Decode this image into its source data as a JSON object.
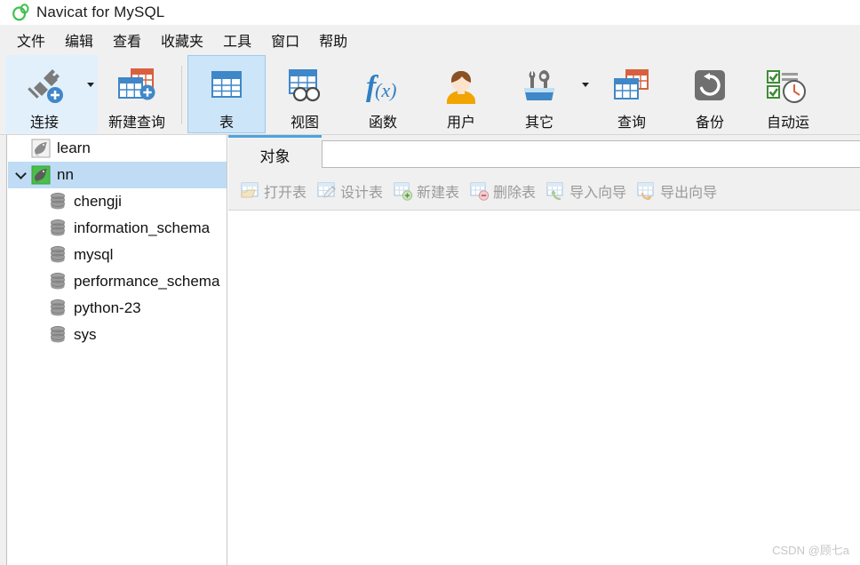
{
  "window": {
    "title": "Navicat for MySQL",
    "logo_icon": "navicat-logo-icon"
  },
  "menubar": {
    "items": [
      {
        "label": "文件",
        "name": "menu-file"
      },
      {
        "label": "编辑",
        "name": "menu-edit"
      },
      {
        "label": "查看",
        "name": "menu-view"
      },
      {
        "label": "收藏夹",
        "name": "menu-favorites"
      },
      {
        "label": "工具",
        "name": "menu-tools"
      },
      {
        "label": "窗口",
        "name": "menu-window"
      },
      {
        "label": "帮助",
        "name": "menu-help"
      }
    ]
  },
  "toolbar": {
    "items": [
      {
        "label": "连接",
        "icon": "connection-plug-add-icon",
        "state": "hover",
        "has_dropdown": true
      },
      {
        "label": "新建查询",
        "icon": "new-query-icon",
        "state": "normal",
        "has_dropdown": false
      },
      {
        "label": "表",
        "icon": "table-icon",
        "state": "active",
        "has_dropdown": false
      },
      {
        "label": "视图",
        "icon": "view-icon",
        "state": "normal",
        "has_dropdown": false
      },
      {
        "label": "函数",
        "icon": "function-fx-icon",
        "state": "normal",
        "has_dropdown": false
      },
      {
        "label": "用户",
        "icon": "user-icon",
        "state": "normal",
        "has_dropdown": false
      },
      {
        "label": "其它",
        "icon": "other-toolbox-icon",
        "state": "normal",
        "has_dropdown": true
      },
      {
        "label": "查询",
        "icon": "query-icon",
        "state": "normal",
        "has_dropdown": false
      },
      {
        "label": "备份",
        "icon": "backup-restore-icon",
        "state": "normal",
        "has_dropdown": false
      },
      {
        "label": "自动运",
        "icon": "automation-checklist-clock-icon",
        "state": "normal",
        "has_dropdown": false
      }
    ]
  },
  "sidebar": {
    "tree": [
      {
        "label": "learn",
        "icon": "connection-dolphin-gray-icon",
        "level": 0,
        "expanded": false,
        "selected": false
      },
      {
        "label": "nn",
        "icon": "connection-dolphin-green-icon",
        "level": 0,
        "expanded": true,
        "selected": true
      },
      {
        "label": "chengji",
        "icon": "database-icon",
        "level": 1,
        "expanded": false,
        "selected": false
      },
      {
        "label": "information_schema",
        "icon": "database-icon",
        "level": 1,
        "expanded": false,
        "selected": false
      },
      {
        "label": "mysql",
        "icon": "database-icon",
        "level": 1,
        "expanded": false,
        "selected": false
      },
      {
        "label": "performance_schema",
        "icon": "database-icon",
        "level": 1,
        "expanded": false,
        "selected": false
      },
      {
        "label": "python-23",
        "icon": "database-icon",
        "level": 1,
        "expanded": false,
        "selected": false
      },
      {
        "label": "sys",
        "icon": "database-icon",
        "level": 1,
        "expanded": false,
        "selected": false
      }
    ]
  },
  "main": {
    "tab": {
      "label": "对象"
    },
    "filter_value": "",
    "filter_placeholder": "",
    "actions": [
      {
        "label": "打开表",
        "icon": "open-table-icon",
        "enabled": false
      },
      {
        "label": "设计表",
        "icon": "design-table-icon",
        "enabled": false
      },
      {
        "label": "新建表",
        "icon": "new-table-icon",
        "enabled": false
      },
      {
        "label": "删除表",
        "icon": "delete-table-icon",
        "enabled": false
      },
      {
        "label": "导入向导",
        "icon": "import-wizard-icon",
        "enabled": false
      },
      {
        "label": "导出向导",
        "icon": "export-wizard-icon",
        "enabled": false
      }
    ]
  },
  "watermark": {
    "text": "CSDN @顾七a"
  },
  "colors": {
    "accent_blue": "#3f87c8",
    "tab_underline": "#4ea3e0",
    "selection": "#bfdcf4",
    "toolbar_bg": "#f0f0f0",
    "active_button": "#cde5f8",
    "connected_green": "#49bf4a",
    "disabled_text": "#9a9a9a"
  }
}
